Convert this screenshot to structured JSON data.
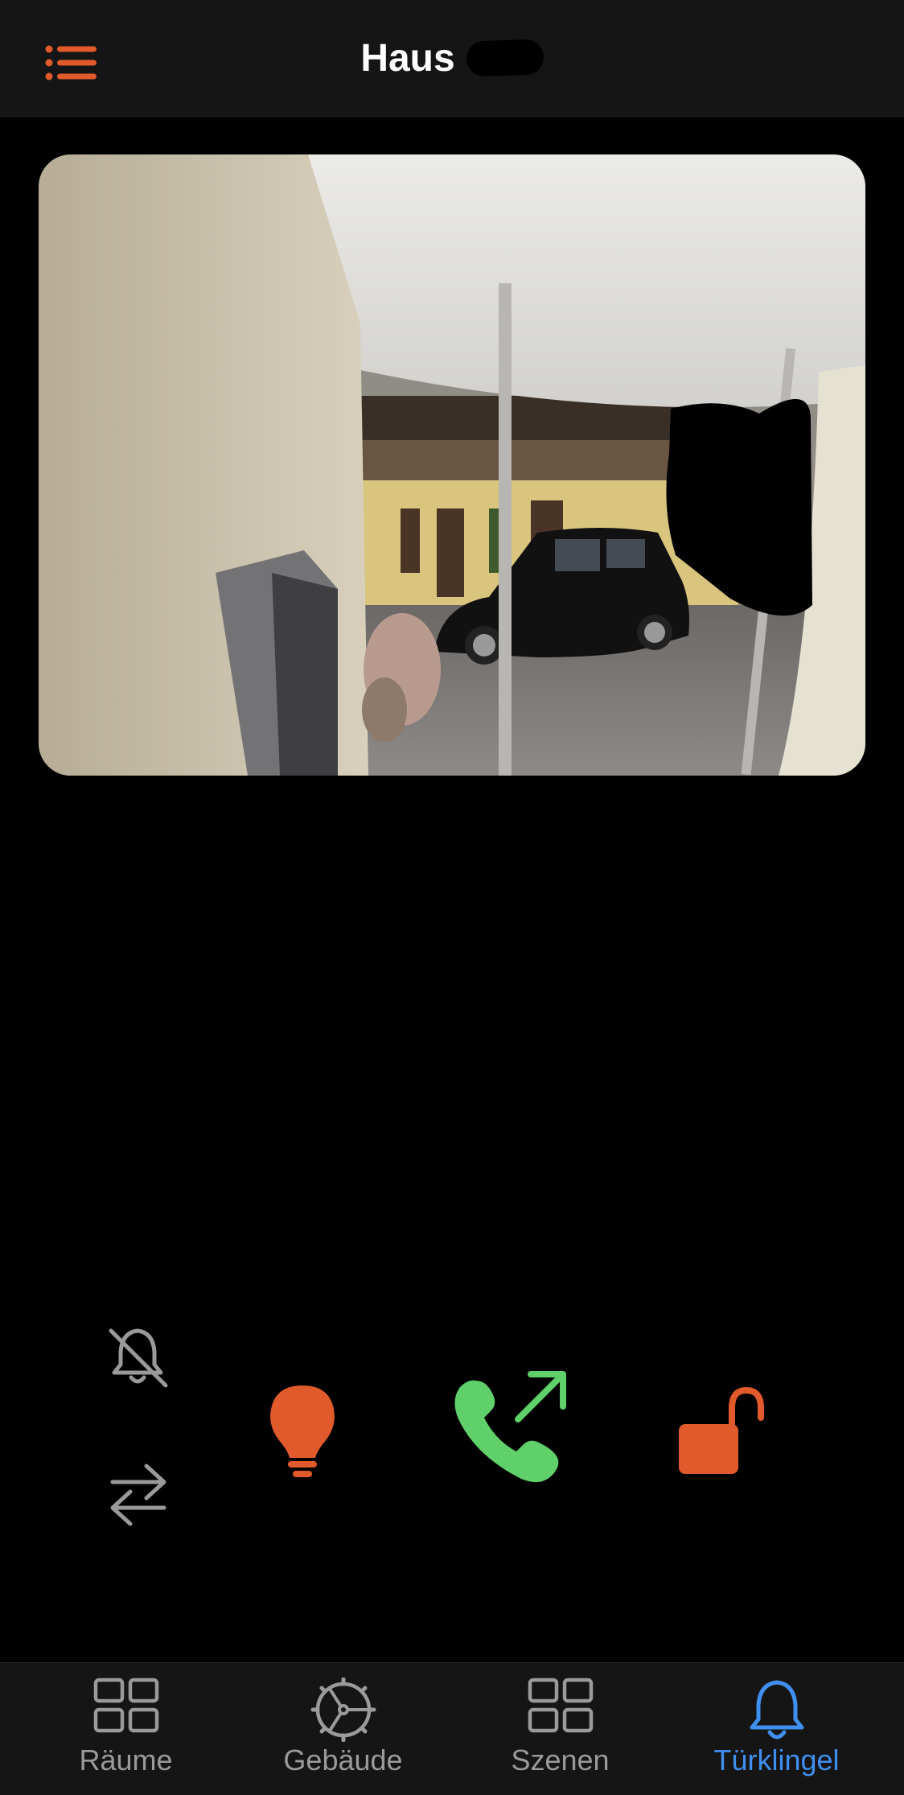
{
  "header": {
    "title": "Haus",
    "menu_icon": "list-icon"
  },
  "camera": {
    "description_icon": "camera-feed"
  },
  "controls": {
    "mute_icon": "bell-slash-icon",
    "switch_icon": "arrows-swap-icon",
    "light_icon": "lightbulb-icon",
    "call_icon": "phone-outgoing-icon",
    "unlock_icon": "lock-open-icon"
  },
  "tabs": [
    {
      "label": "Räume",
      "icon": "grid-icon",
      "active": false
    },
    {
      "label": "Gebäude",
      "icon": "building-wheel-icon",
      "active": false
    },
    {
      "label": "Szenen",
      "icon": "grid-icon",
      "active": false
    },
    {
      "label": "Türklingel",
      "icon": "bell-icon",
      "active": true
    }
  ],
  "colors": {
    "accent_orange": "#e05a2b",
    "call_green": "#5fd06a",
    "active_tab_blue": "#3f8ff0",
    "inactive_gray": "#9a9a9a",
    "bar_bg": "#151515"
  }
}
